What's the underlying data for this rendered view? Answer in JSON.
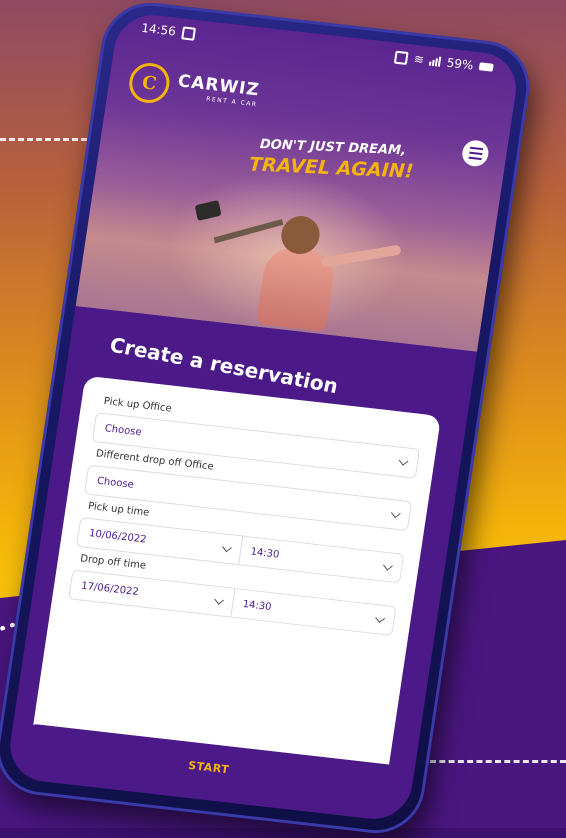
{
  "status_bar": {
    "time": "14:56",
    "battery": "59%"
  },
  "brand": {
    "name": "CARWIZ",
    "subtitle": "RENT A CAR",
    "mark": "C",
    "accent": "#f5b40b",
    "primary": "#4b1a88"
  },
  "hero": {
    "line1": "DON'T JUST DREAM,",
    "line2": "TRAVEL AGAIN!"
  },
  "reservation": {
    "title": "Create a reservation",
    "pickup_office_label": "Pick up Office",
    "pickup_office_value": "Choose",
    "dropoff_office_label": "Different drop off Office",
    "dropoff_office_value": "Choose",
    "pickup_time_label": "Pick up time",
    "pickup_date": "10/06/2022",
    "pickup_hour": "14:30",
    "dropoff_time_label": "Drop off time",
    "dropoff_date": "17/06/2022",
    "dropoff_hour": "14:30",
    "start_label": "START"
  },
  "icons": [
    "menu-icon",
    "wifi-icon",
    "signal-icon",
    "battery-icon",
    "chevron-down-icon"
  ]
}
